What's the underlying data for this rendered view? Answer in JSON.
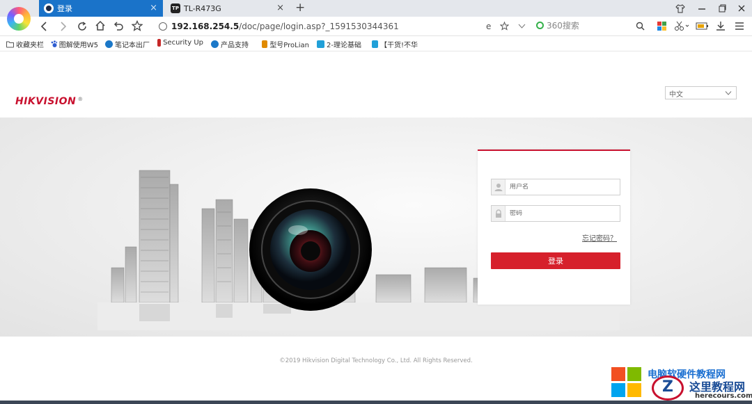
{
  "browser": {
    "tabs": [
      {
        "label": "登录",
        "active": true
      },
      {
        "label": "TL-R473G",
        "active": false
      }
    ],
    "tab_icon_tp": "TP",
    "close_glyph": "×",
    "newtab_glyph": "+",
    "address": {
      "host": "192.168.254.5",
      "path": "/doc/page/login.asp?_1591530344361"
    },
    "search_placeholder": "360搜索",
    "bookmarks": [
      "收藏夹栏",
      "图解使用W5",
      "笔记本出厂",
      "Security Up",
      "产品支持",
      "型号ProLian",
      "2-理论基础",
      "【干货!不华"
    ],
    "accent": "#1a73c9"
  },
  "page": {
    "logo": "HIKVISION",
    "logo_reg": "®",
    "language": "中文",
    "login": {
      "username_placeholder": "用户名",
      "password_placeholder": "密码",
      "forgot": "忘记密码？",
      "submit": "登录"
    },
    "copyright": "©2019 Hikvision Digital Technology Co., Ltd. All Rights Reserved.",
    "brand_color": "#c8102e"
  },
  "watermark": {
    "top_text": "电脑软硬件教程网",
    "title": "这里教程网",
    "url": "herecours.com",
    "letter": "Z"
  }
}
